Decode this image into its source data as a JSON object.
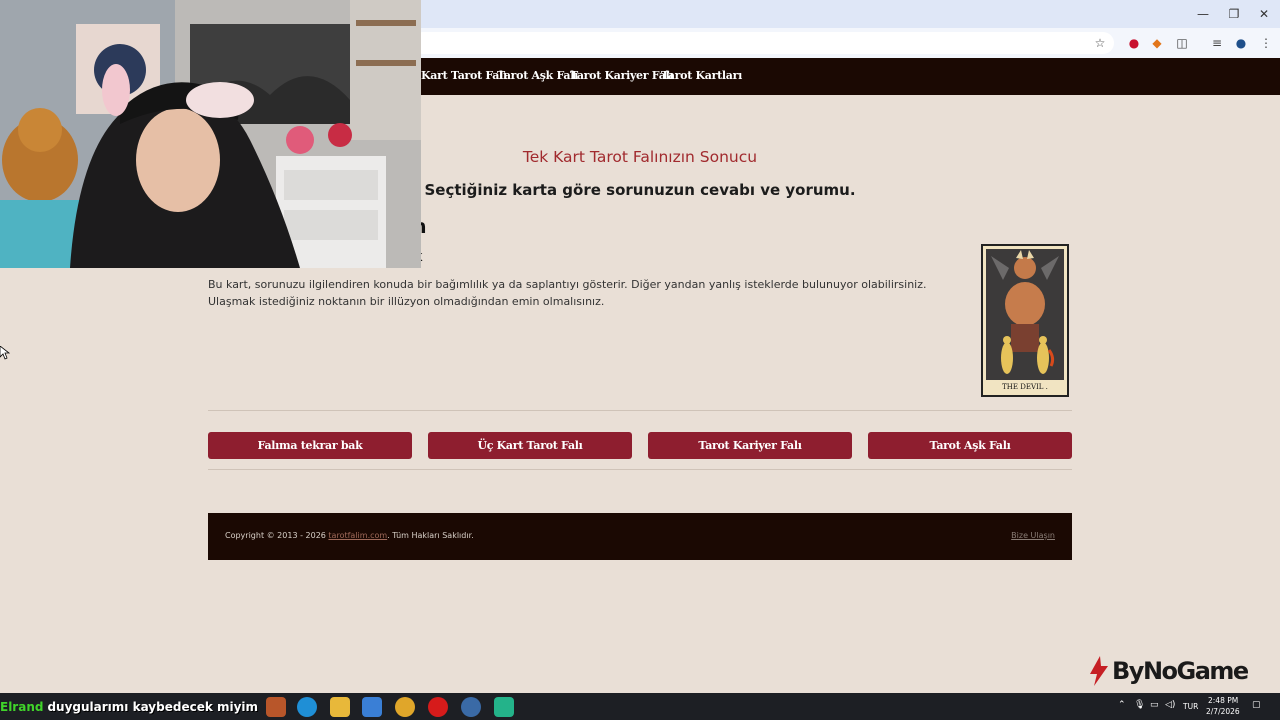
{
  "browser": {
    "window_controls": {
      "minimize": "—",
      "restore": "❐",
      "close": "✕"
    },
    "toolbar_icons": [
      "star-icon",
      "extension-badge-icon",
      "metamask-icon",
      "puzzle-icon",
      "media-icon",
      "profile-icon",
      "menu-dots-icon"
    ]
  },
  "nav": {
    "items": [
      {
        "label": "Kart Tarot Falı"
      },
      {
        "label": "Tarot Aşk Falı"
      },
      {
        "label": "Tarot Kariyer Falı"
      },
      {
        "label": "Tarot Kartları"
      }
    ]
  },
  "result": {
    "title": "Tek Kart Tarot Falınızın Sonucu",
    "subtitle": "Seçtiğiniz karta göre sorunuzun cevabı ve yorumu.",
    "hidden_title_fragment": "n",
    "hidden_title_fragment_2": "k",
    "description": "Bu kart, sorunuzu ilgilendiren konuda bir bağımlılık ya da saplantıyı gösterir. Diğer yandan yanlış isteklerde bulunuyor olabilirsiniz. Ulaşmak istediğiniz noktanın bir illüzyon olmadığından emin olmalısınız.",
    "card_caption": "THE DEVIL ."
  },
  "actions": [
    {
      "label": "Falıma tekrar bak"
    },
    {
      "label": "Üç Kart Tarot Falı"
    },
    {
      "label": "Tarot Kariyer Falı"
    },
    {
      "label": "Tarot Aşk Falı"
    }
  ],
  "footer": {
    "copyright_prefix": "Copyright © 2013 - 2026 ",
    "site_link": "tarotfalim.com",
    "copyright_suffix": ". Tüm Hakları Saklıdır.",
    "contact": "Bize Ulaşın"
  },
  "overlay": {
    "chat_user": "Elrand",
    "chat_message": "duygularımı kaybedecek miyim",
    "watermark": "ByNoGame"
  },
  "taskbar": {
    "language": "TUR",
    "time": "2:48 PM",
    "date": "2/7/2026",
    "app_icons": [
      "media-app-icon",
      "edge-icon",
      "file-explorer-icon",
      "store-icon",
      "chrome-icon",
      "opera-icon",
      "chrome-active-icon",
      "green-app-icon"
    ]
  },
  "colors": {
    "page_bg": "#e9dfd6",
    "nav_bg": "#1b0903",
    "accent_red": "#a12a2e",
    "button_bg": "#8e1e2f"
  }
}
